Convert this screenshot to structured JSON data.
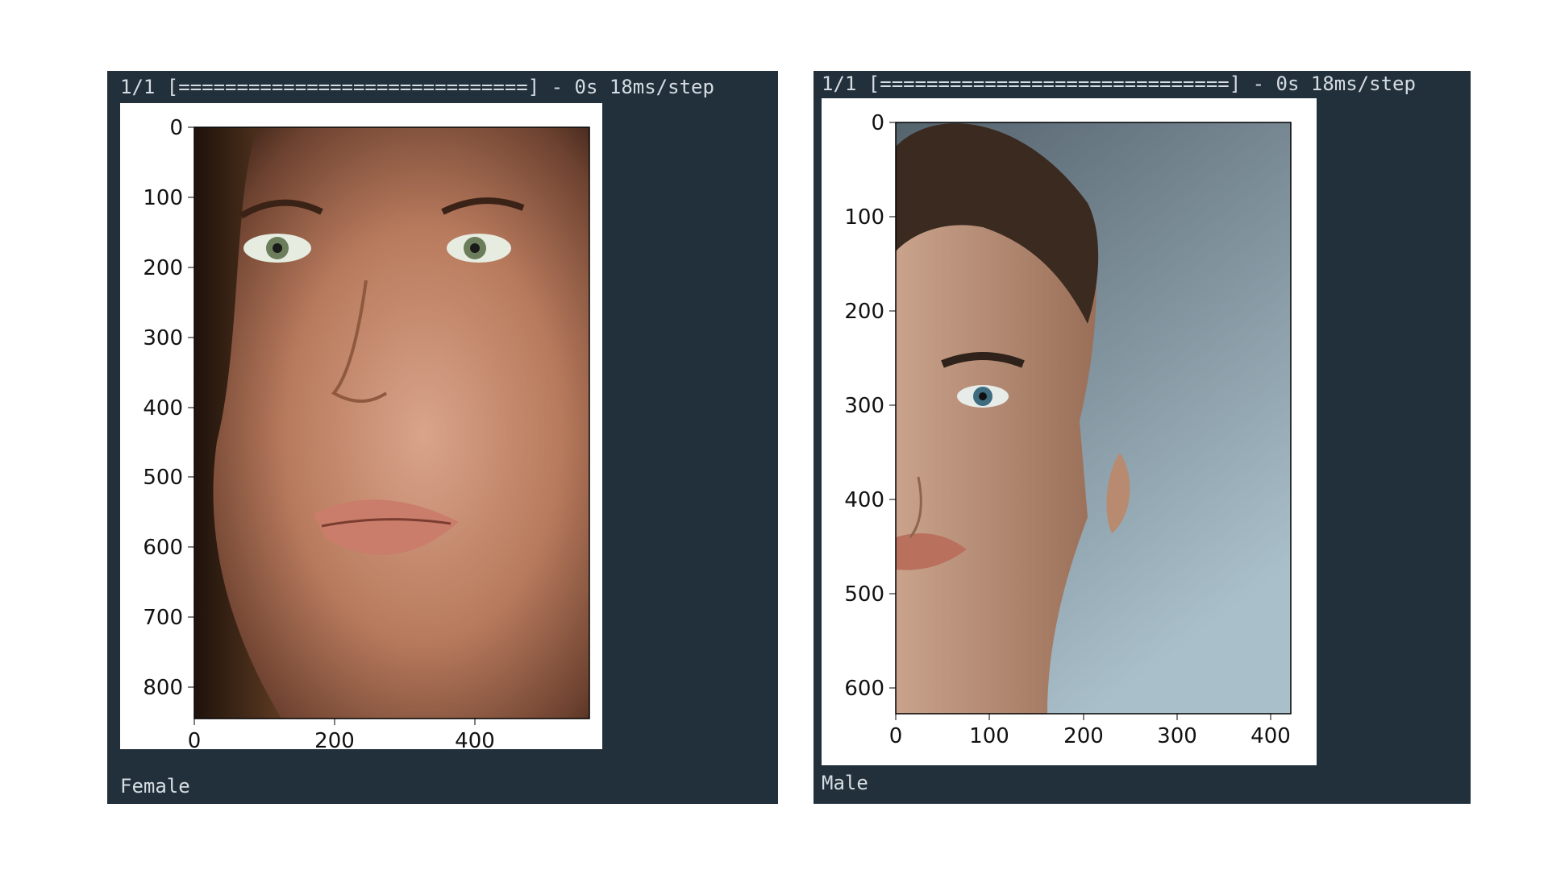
{
  "panels": [
    {
      "log": "1/1 [==============================] - 0s 18ms/step",
      "label": "Female",
      "plot": {
        "y_ticks": [
          "0",
          "100",
          "200",
          "300",
          "400",
          "500",
          "600",
          "700",
          "800"
        ],
        "x_ticks": [
          "0",
          "200",
          "400"
        ]
      }
    },
    {
      "log": "1/1 [==============================] - 0s 18ms/step",
      "label": "Male",
      "plot": {
        "y_ticks": [
          "0",
          "100",
          "200",
          "300",
          "400",
          "500",
          "600"
        ],
        "x_ticks": [
          "0",
          "100",
          "200",
          "300",
          "400"
        ]
      }
    }
  ]
}
